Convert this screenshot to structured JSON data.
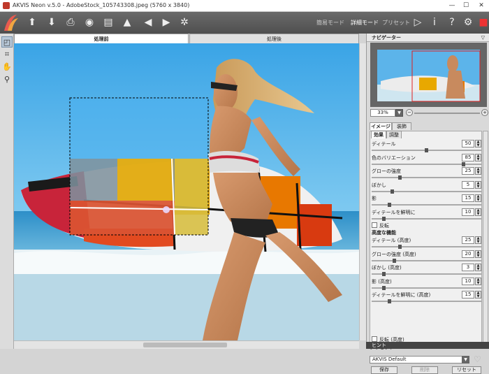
{
  "window": {
    "title": "AKVIS Neon v.5.0 - AdobeStock_105743308.jpeg (5760 x 3840)",
    "min": "—",
    "max": "☐",
    "close": "✕"
  },
  "toolbar": {
    "mode_simple": "簡易モード",
    "mode_advanced": "詳細モード",
    "mode_presets": "プリセット"
  },
  "view_tabs": {
    "before": "処理前",
    "after": "処理後"
  },
  "panel": {
    "navigator_title": "ナビゲーター",
    "zoom": "33%",
    "tabs": {
      "image": "イメージ",
      "decor": "装飾"
    },
    "subtabs": {
      "effect": "効果",
      "adjust": "調整"
    },
    "params": [
      {
        "label": "ディテール",
        "value": "50",
        "pos": 0.5
      },
      {
        "label": "色のバリエーション",
        "value": "85",
        "pos": 0.85
      },
      {
        "label": "グローの強度",
        "value": "25",
        "pos": 0.25
      },
      {
        "label": "ぼかし",
        "value": "5",
        "pos": 0.18
      },
      {
        "label": "影",
        "value": "15",
        "pos": 0.15
      },
      {
        "label": "ディテールを鮮明に",
        "value": "10",
        "pos": 0.1
      }
    ],
    "invert": "反転",
    "advanced_title": "高度な機能",
    "adv_params": [
      {
        "label": "ディテール (高度)",
        "value": "25",
        "pos": 0.25
      },
      {
        "label": "グローの強度 (高度)",
        "value": "20",
        "pos": 0.2
      },
      {
        "label": "ぼかし (高度)",
        "value": "3",
        "pos": 0.1
      },
      {
        "label": "影 (高度)",
        "value": "10",
        "pos": 0.1
      },
      {
        "label": "ディテールを鮮明に (高度)",
        "value": "15",
        "pos": 0.15
      }
    ],
    "adv_invert": "反転 (高度)",
    "preset_label": "プリセット",
    "preset_value": "AKVIS Default",
    "save": "保存",
    "delete": "削除",
    "reset": "リセット",
    "bottom_hint": "ヒント"
  }
}
